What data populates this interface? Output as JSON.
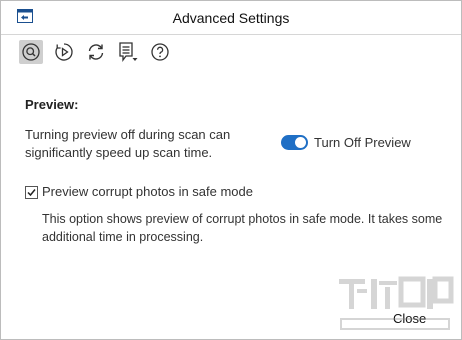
{
  "window": {
    "title": "Advanced Settings"
  },
  "toolbar": {
    "buttons": [
      {
        "icon": "search-preview-icon",
        "active": true
      },
      {
        "icon": "play-icon",
        "active": false
      },
      {
        "icon": "refresh-icon",
        "active": false
      },
      {
        "icon": "list-dropdown-icon",
        "active": false
      },
      {
        "icon": "help-icon",
        "active": false
      }
    ]
  },
  "preview": {
    "heading": "Preview:",
    "description": "Turning preview off during scan can significantly speed up scan time.",
    "toggle_label": "Turn Off Preview",
    "toggle_on": true,
    "checkbox_label": "Preview corrupt photos in safe mode",
    "checkbox_checked": true,
    "info": "This option shows preview of corrupt photos in safe mode. It takes some additional time in processing."
  },
  "footer": {
    "close_label": "Close"
  },
  "colors": {
    "accent": "#1f6fc5",
    "toolbar_active": "#cfcfcf",
    "border": "#bcbcbc"
  }
}
